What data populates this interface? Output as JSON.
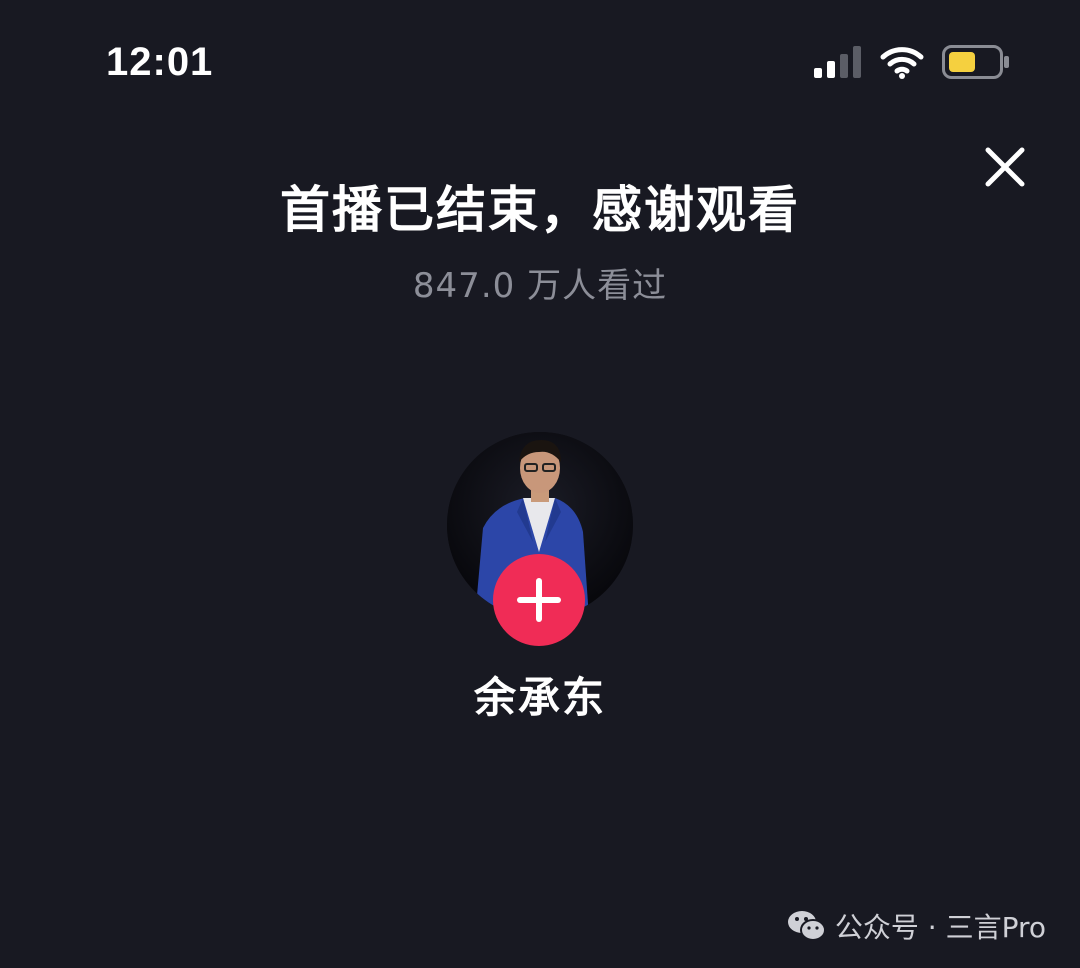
{
  "status_bar": {
    "time": "12:01",
    "icons": [
      "signal-icon",
      "wifi-icon",
      "battery-icon"
    ],
    "battery_color": "#f5d03f"
  },
  "header": {
    "close_icon": "close-icon"
  },
  "main": {
    "title": "首播已结束，感谢观看",
    "viewers": "847.0 万人看过",
    "streamer_name": "余承东",
    "follow_icon": "plus-icon",
    "follow_color": "#f02c56"
  },
  "watermark": {
    "icon": "wechat-icon",
    "text": "公众号 · 三言Pro"
  }
}
